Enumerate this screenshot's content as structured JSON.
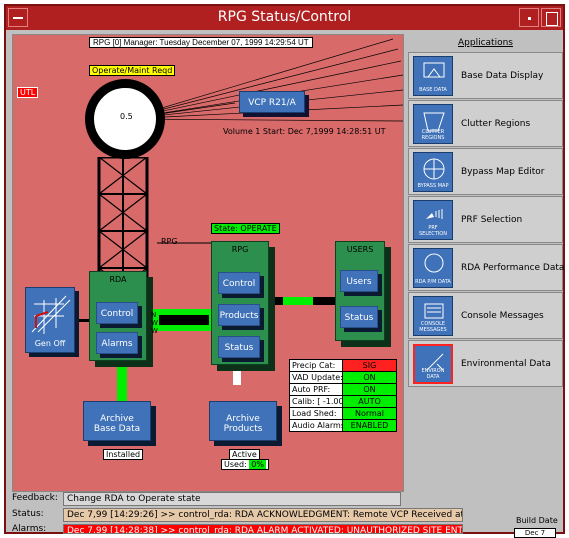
{
  "window": {
    "title": "RPG Status/Control"
  },
  "header": {
    "text": "RPG [0] Manager: Tuesday December 07, 1999   14:29:54 UT"
  },
  "utl_label": "UTL",
  "radar": {
    "state_label": "Operate/Maint Reqd",
    "value": "0.5",
    "vcp_label": "VCP R21/A",
    "volume_text": "Volume 1 Start: Dec 7,1999   14:28:51 UT"
  },
  "rpg_state": "State: OPERATE",
  "rpg_link_label": "RPG",
  "rda": {
    "title": "RDA",
    "control": "Control",
    "alarms": "Alarms",
    "nb_labels": [
      "N",
      "W",
      "W"
    ]
  },
  "rpg": {
    "title": "RPG",
    "control": "Control",
    "products": "Products",
    "status": "Status"
  },
  "users": {
    "title": "USERS",
    "users": "Users",
    "status": "Status"
  },
  "generator": {
    "label": "Gen Off"
  },
  "archive_base": {
    "label_line1": "Archive",
    "label_line2": "Base Data",
    "tag": "Installed"
  },
  "archive_products": {
    "label_line1": "Archive",
    "label_line2": "Products",
    "tag": "Active",
    "used_label": "Used:",
    "used_value": "0%"
  },
  "params": [
    {
      "name": "Precip Cat:",
      "value": "SIG",
      "color": "#ff2020"
    },
    {
      "name": "VAD Update:",
      "value": "ON",
      "color": "#00ee00"
    },
    {
      "name": "Auto PRF:",
      "value": "ON",
      "color": "#00ee00"
    },
    {
      "name": "Calib: [ -1.00]:",
      "value": "AUTO",
      "color": "#00ee00"
    },
    {
      "name": "Load Shed:",
      "value": "Normal",
      "color": "#00ee00"
    },
    {
      "name": "Audio Alarms:",
      "value": "ENABLED",
      "color": "#00ee00"
    }
  ],
  "applications": {
    "title": "Applications",
    "items": [
      {
        "name": "Base Data Display",
        "icon": "base-data-icon",
        "icon_text": "BASE DATA"
      },
      {
        "name": "Clutter Regions",
        "icon": "clutter-regions-icon",
        "icon_text": "CLUTTER REGIONS"
      },
      {
        "name": "Bypass Map Editor",
        "icon": "bypass-map-icon",
        "icon_text": "BYPASS MAP"
      },
      {
        "name": "PRF Selection",
        "icon": "prf-selection-icon",
        "icon_text": "PRF SELECTION"
      },
      {
        "name": "RDA Performance Data",
        "icon": "rda-performance-icon",
        "icon_text": "RDA P/M DATA"
      },
      {
        "name": "Console Messages",
        "icon": "console-messages-icon",
        "icon_text": "CONSOLE MESSAGES"
      },
      {
        "name": "Environmental Data",
        "icon": "environmental-data-icon",
        "icon_text": "ENVIRON DATA"
      }
    ]
  },
  "feedback": {
    "label": "Feedback:",
    "text": "Change RDA to Operate state"
  },
  "status": {
    "label": "Status:",
    "text": "Dec 7,99 [14:29:26] >> control_rda: RDA ACKNOWLEDGMENT: Remote VCP Received at RDA"
  },
  "alarms": {
    "label": "Alarms:",
    "text": "Dec 7,99 [14:28:38] >> control_rda: RDA ALARM ACTIVATED: UNAUTHORIZED SITE ENTRY"
  },
  "build": {
    "label": "Build Date",
    "value": "Dec 7 1999"
  }
}
